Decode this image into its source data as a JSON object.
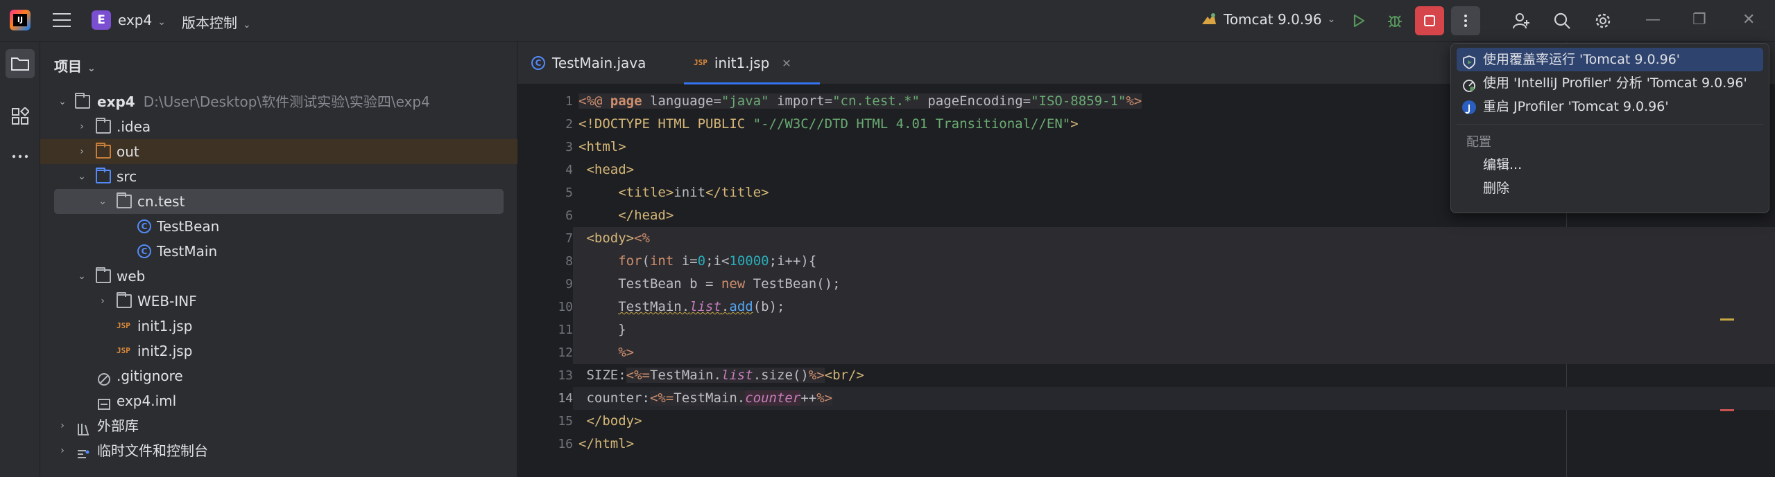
{
  "titlebar": {
    "project_initial": "E",
    "project_name": "exp4",
    "vcs_label": "版本控制",
    "run_config": "Tomcat 9.0.96"
  },
  "project_panel": {
    "title": "项目",
    "tree": [
      {
        "label": "exp4",
        "path": "D:\\User\\Desktop\\软件测试实验\\实验四\\exp4"
      },
      {
        "label": ".idea"
      },
      {
        "label": "out"
      },
      {
        "label": "src"
      },
      {
        "label": "cn.test"
      },
      {
        "label": "TestBean"
      },
      {
        "label": "TestMain"
      },
      {
        "label": "web"
      },
      {
        "label": "WEB-INF"
      },
      {
        "label": "init1.jsp"
      },
      {
        "label": "init2.jsp"
      },
      {
        "label": ".gitignore"
      },
      {
        "label": "exp4.iml"
      },
      {
        "label": "外部库"
      },
      {
        "label": "临时文件和控制台"
      }
    ]
  },
  "editor": {
    "tabs": [
      {
        "label": "TestMain.java"
      },
      {
        "label": "init1.jsp"
      }
    ],
    "line_numbers": [
      "1",
      "2",
      "3",
      "4",
      "5",
      "6",
      "7",
      "8",
      "9",
      "10",
      "11",
      "12",
      "13",
      "14",
      "15",
      "16"
    ],
    "code": {
      "l1a": "<%@ ",
      "l1b": "page",
      "l1c": " language=",
      "l1d": "\"java\"",
      "l1e": " import=",
      "l1f": "\"cn.test.*\"",
      "l1g": " pageEncoding=",
      "l1h": "\"ISO-8859-1\"",
      "l1i": "%>",
      "l2a": "<!DOCTYPE HTML PUBLIC ",
      "l2b": "\"-//W3C//DTD HTML 4.01 Transitional//EN\"",
      "l2c": ">",
      "l3": "<html>",
      "l4": " <head>",
      "l5a": "     <title>",
      "l5b": "init",
      "l5c": "</title>",
      "l6": "     </head>",
      "l7a": " <body>",
      "l7b": "<%",
      "l8a": "     ",
      "l8b": "for",
      "l8c": "(",
      "l8d": "int",
      "l8e": " i=",
      "l8f": "0",
      "l8g": ";i<",
      "l8h": "10000",
      "l8i": ";i++){",
      "l9a": "     TestBean b = ",
      "l9b": "new",
      "l9c": " TestBean();",
      "l10a": "     ",
      "l10b": "TestMain.",
      "l10c": "list",
      "l10d": ".",
      "l10e": "add",
      "l10f": "(b);",
      "l11": "     }",
      "l12": "     %>",
      "l13a": " SIZE:",
      "l13b": "<%=",
      "l13c": "TestMain.",
      "l13d": "list",
      "l13e": ".size()",
      "l13f": "%>",
      "l13g": "<br/>",
      "l14a": " counter:",
      "l14b": "<%=",
      "l14c": "TestMain.",
      "l14d": "counter",
      "l14e": "++",
      "l14f": "%>",
      "l15": " </body>",
      "l16": "</html>"
    }
  },
  "popup": {
    "items": [
      {
        "label": "使用覆盖率运行 'Tomcat 9.0.96'"
      },
      {
        "label": "使用 'IntelliJ Profiler' 分析  'Tomcat 9.0.96'"
      },
      {
        "label": "重启 JProfiler 'Tomcat 9.0.96'"
      }
    ],
    "section_title": "配置",
    "edit_label": "编辑...",
    "delete_label": "删除"
  },
  "colors": {
    "accent": "#3574f0",
    "run_green": "#57965c",
    "stop_red": "#d6454a",
    "folder_orange": "#c77d3a",
    "folder_blue": "#548af7"
  }
}
